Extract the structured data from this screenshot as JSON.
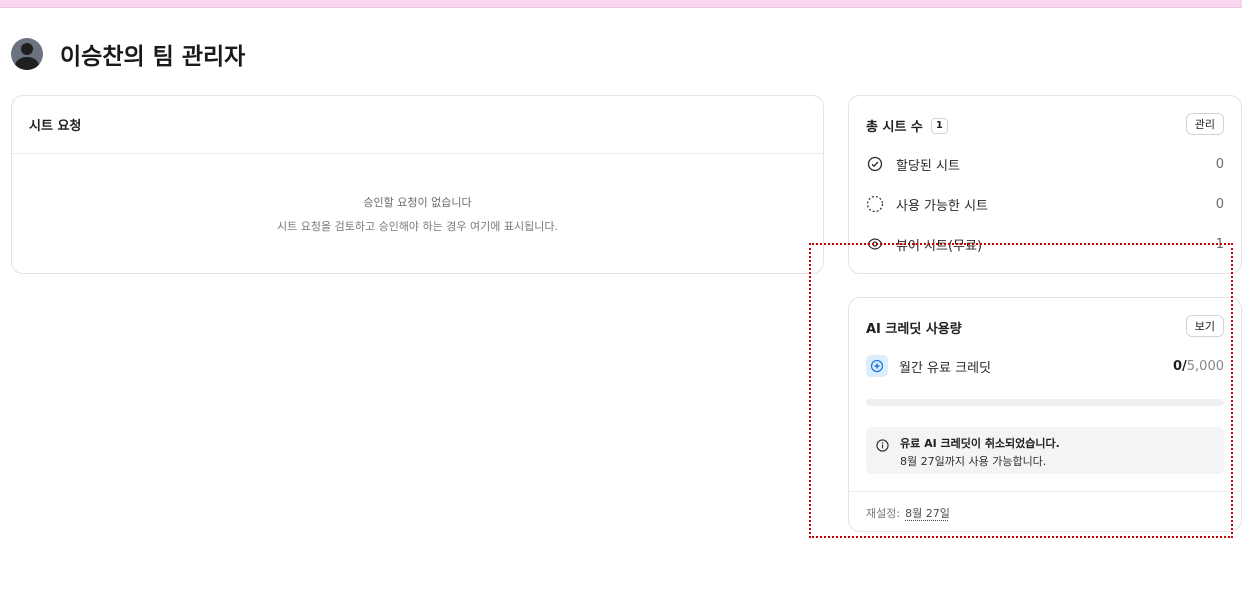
{
  "header": {
    "title": "이승찬의 팀 관리자"
  },
  "seat_requests": {
    "title": "시트 요청",
    "empty_title": "승인할 요청이 없습니다",
    "empty_desc": "시트 요청을 검토하고 승인해야 하는 경우 여기에 표시됩니다."
  },
  "seats": {
    "title": "총 시트 수",
    "count": "1",
    "manage_label": "관리",
    "rows": [
      {
        "label": "할당된 시트",
        "value": "0",
        "icon": "check-circle-icon"
      },
      {
        "label": "사용 가능한 시트",
        "value": "0",
        "icon": "dashed-circle-icon"
      },
      {
        "label": "뷰어 시트(무료)",
        "value": "1",
        "icon": "eye-icon"
      }
    ]
  },
  "ai_credits": {
    "title": "AI 크레딧 사용량",
    "view_label": "보기",
    "credit_label": "월간 유료 크레딧",
    "used": "0",
    "separator": "/",
    "total": "5,000",
    "usage_fraction": 0,
    "notice_title": "유료 AI 크레딧이 취소되었습니다.",
    "notice_desc": "8월 27일까지 사용 가능합니다.",
    "reset_label": "재설정:",
    "reset_date": "8월 27일"
  },
  "colors": {
    "accent": "#3b82f6",
    "annotation": "#cc0000",
    "topbar": "#f9d6ef"
  }
}
